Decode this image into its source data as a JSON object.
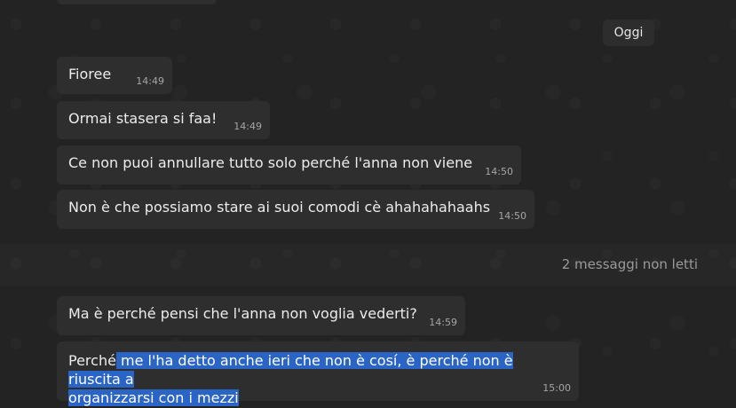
{
  "date_chip": "Oggi",
  "messages": [
    {
      "text": "Fioree",
      "time": "14:49"
    },
    {
      "text": "Ormai stasera si faa!",
      "time": "14:49"
    },
    {
      "text": "Ce non puoi annullare tutto solo perché l'anna non viene",
      "time": "14:50"
    },
    {
      "text": "Non è che possiamo stare ai suoi comodi cè ahahahahaahs",
      "time": "14:50"
    }
  ],
  "unread_divider": "2 messaggi non letti",
  "unread_messages": [
    {
      "text": "Ma è perché pensi che l'anna non voglia vederti?",
      "time": "14:59"
    },
    {
      "text_unselected": "Perché",
      "text_selected_line1": " me l'ha detto anche ieri che non è cosí, è perché non è riuscita a",
      "text_selected_line2": "organizzarsi con i mezzi",
      "time": "15:00"
    }
  ]
}
